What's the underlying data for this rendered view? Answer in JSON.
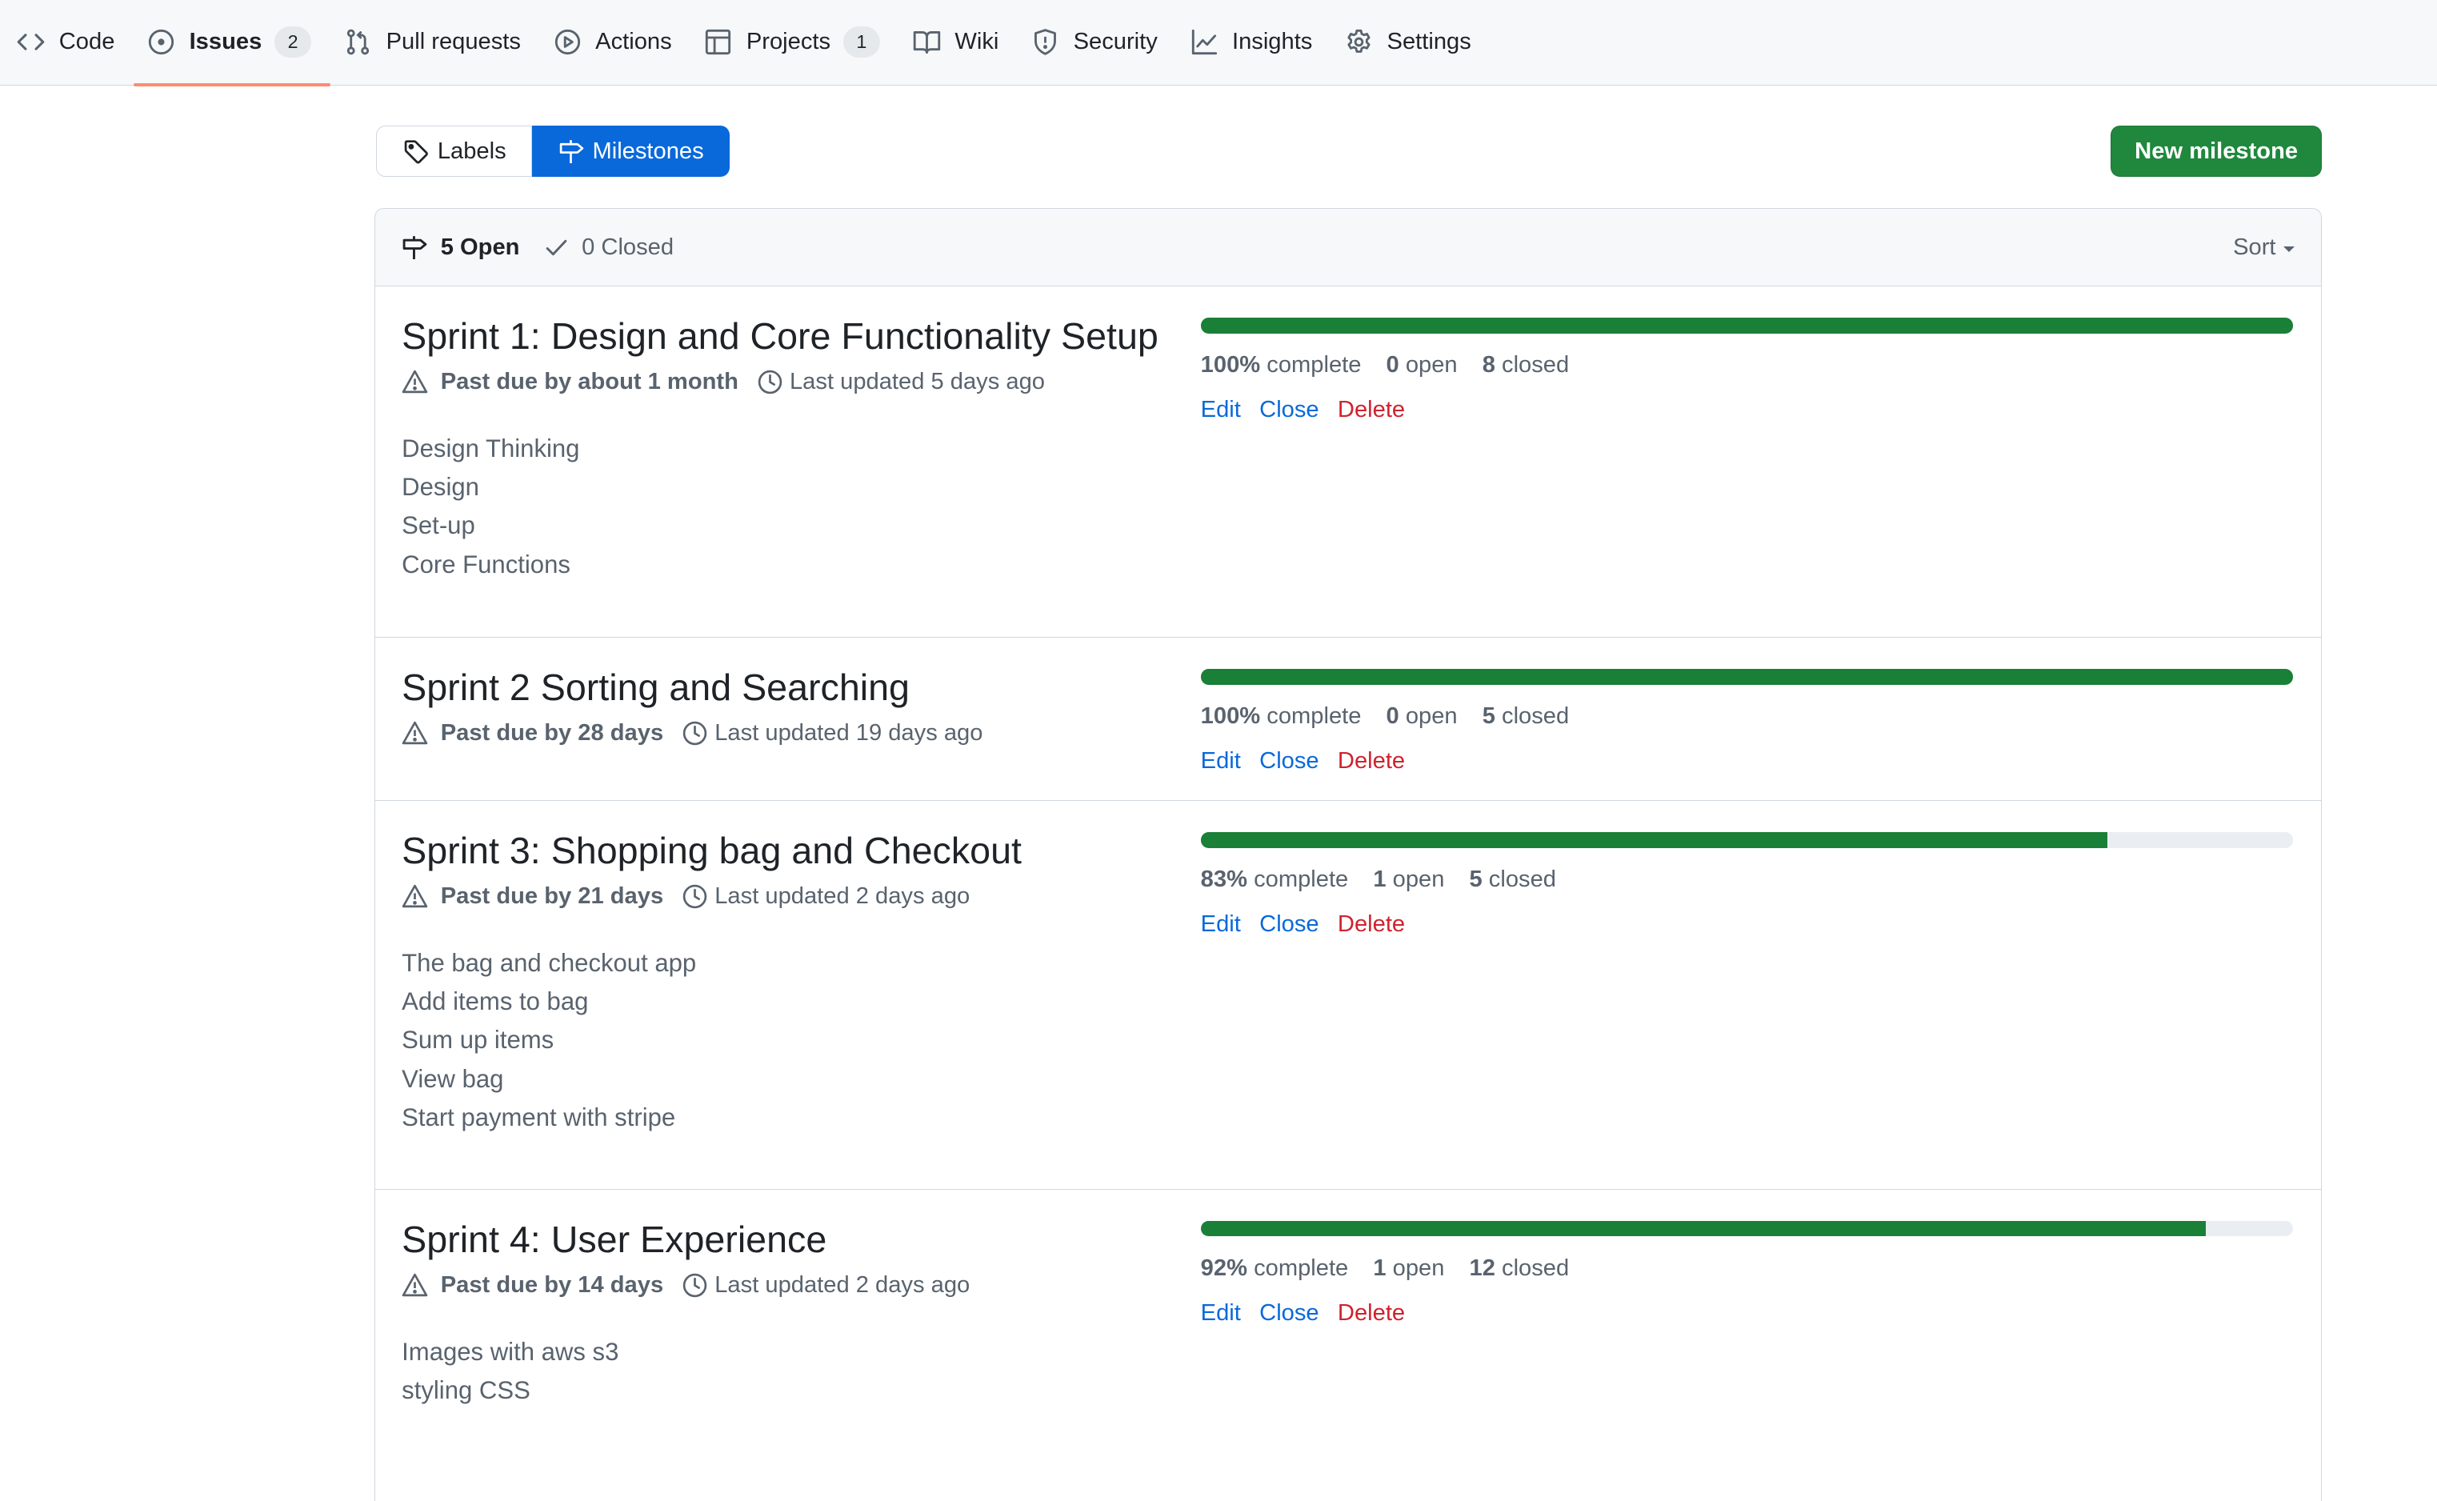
{
  "nav": {
    "items": [
      {
        "id": "code",
        "label": "Code",
        "icon": "code-icon"
      },
      {
        "id": "issues",
        "label": "Issues",
        "icon": "issue-opened-icon",
        "count": "2",
        "active": true
      },
      {
        "id": "pulls",
        "label": "Pull requests",
        "icon": "git-pull-request-icon"
      },
      {
        "id": "actions",
        "label": "Actions",
        "icon": "play-icon"
      },
      {
        "id": "projects",
        "label": "Projects",
        "icon": "table-icon",
        "count": "1"
      },
      {
        "id": "wiki",
        "label": "Wiki",
        "icon": "book-icon"
      },
      {
        "id": "security",
        "label": "Security",
        "icon": "shield-icon"
      },
      {
        "id": "insights",
        "label": "Insights",
        "icon": "graph-icon"
      },
      {
        "id": "settings",
        "label": "Settings",
        "icon": "gear-icon"
      }
    ]
  },
  "subnav": {
    "labels": "Labels",
    "milestones": "Milestones",
    "new_milestone": "New milestone"
  },
  "header": {
    "open": "5 Open",
    "closed": "0 Closed",
    "sort": "Sort"
  },
  "milestones": [
    {
      "title": "Sprint 1: Design and Core Functionality Setup",
      "due": "Past due by about 1 month",
      "updated": "Last updated 5 days ago",
      "description": [
        "Design Thinking",
        "Design",
        "Set-up",
        "Core Functions"
      ],
      "percent": "100%",
      "progress": 1.0,
      "open_count": "0",
      "closed_count": "8",
      "complete_label": "complete",
      "open_label": "open",
      "closed_label": "closed"
    },
    {
      "title": "Sprint 2 Sorting and Searching",
      "due": "Past due by 28 days",
      "updated": "Last updated 19 days ago",
      "description": [],
      "percent": "100%",
      "progress": 1.0,
      "open_count": "0",
      "closed_count": "5",
      "complete_label": "complete",
      "open_label": "open",
      "closed_label": "closed"
    },
    {
      "title": "Sprint 3: Shopping bag and Checkout",
      "due": "Past due by 21 days",
      "updated": "Last updated 2 days ago",
      "description": [
        "The bag and checkout app",
        "Add items to bag",
        "Sum up items",
        "View bag",
        "Start payment with stripe"
      ],
      "percent": "83%",
      "progress": 0.83,
      "open_count": "1",
      "closed_count": "5",
      "complete_label": "complete",
      "open_label": "open",
      "closed_label": "closed"
    },
    {
      "title": "Sprint 4: User Experience",
      "due": "Past due by 14 days",
      "updated": "Last updated 2 days ago",
      "description": [
        "Images with aws s3",
        "styling CSS"
      ],
      "percent": "92%",
      "progress": 0.92,
      "open_count": "1",
      "closed_count": "12",
      "complete_label": "complete",
      "open_label": "open",
      "closed_label": "closed"
    }
  ],
  "actions": {
    "edit": "Edit",
    "close": "Close",
    "delete": "Delete"
  },
  "colors": {
    "accent": "#0969da",
    "success": "#1a7f37",
    "primary_button": "#1f883d",
    "danger": "#cf222e",
    "active_tab_underline": "#fd8c73"
  }
}
